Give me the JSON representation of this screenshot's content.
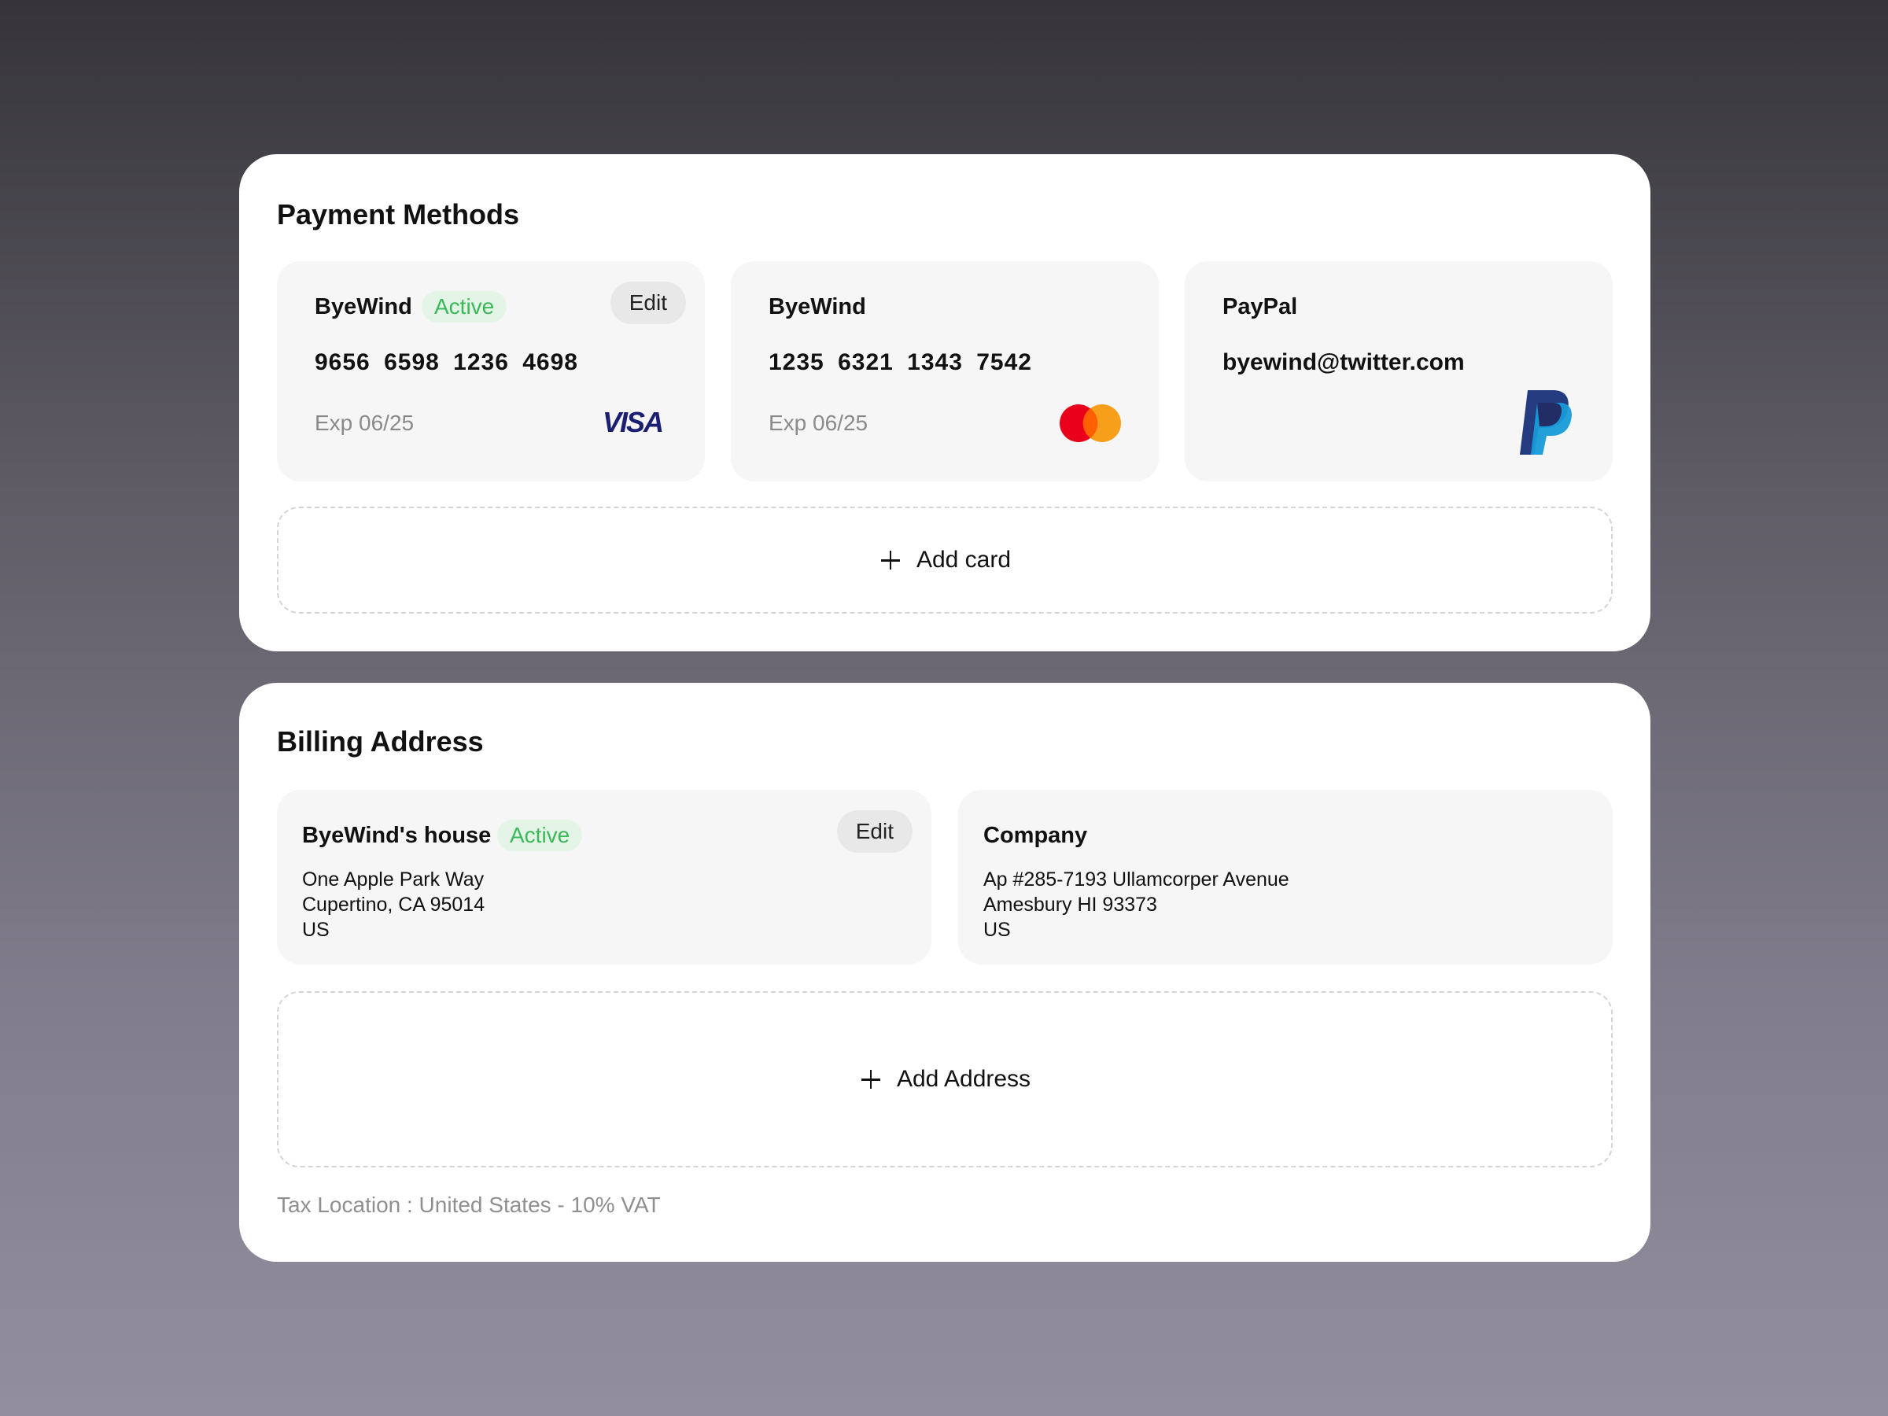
{
  "payment": {
    "title": "Payment Methods",
    "cards": [
      {
        "name": "ByeWind",
        "badge": "Active",
        "edit": "Edit",
        "number": "9656 6598 1236 4698",
        "exp": "Exp 06/25",
        "brand_icon": "visa-icon"
      },
      {
        "name": "ByeWind",
        "number": "1235 6321 1343 7542",
        "exp": "Exp 06/25",
        "brand_icon": "mastercard-icon"
      },
      {
        "name": "PayPal",
        "email": "byewind@twitter.com",
        "brand_icon": "paypal-icon"
      }
    ],
    "add_label": "Add card"
  },
  "billing": {
    "title": "Billing Address",
    "addresses": [
      {
        "name": "ByeWind's house",
        "badge": "Active",
        "edit": "Edit",
        "lines": [
          "One Apple Park Way",
          "Cupertino, CA 95014",
          "US"
        ]
      },
      {
        "name": "Company",
        "lines": [
          "Ap #285-7193 Ullamcorper Avenue",
          "Amesbury HI 93373",
          "US"
        ]
      }
    ],
    "add_label": "Add Address",
    "tax": "Tax Location : United States - 10% VAT"
  },
  "colors": {
    "active_badge_bg": "#e4f4e7",
    "active_badge_text": "#3cb85a",
    "visa_blue": "#1a1f71",
    "mastercard_red": "#eb001b",
    "mastercard_orange": "#f79e1b",
    "paypal_dark": "#253b80",
    "paypal_light": "#179bd7"
  }
}
